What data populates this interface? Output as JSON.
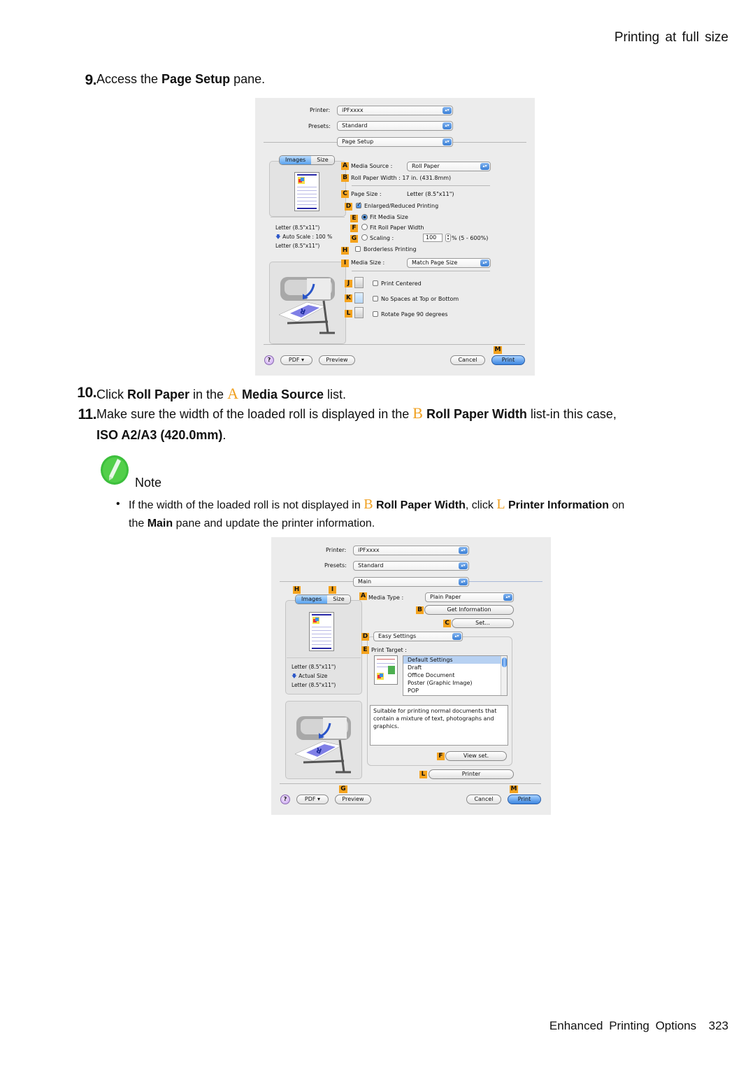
{
  "page": {
    "running_head": "Printing at full size",
    "footer_section": "Enhanced Printing Options",
    "page_number": "323"
  },
  "steps": [
    {
      "number": "9.",
      "parts": [
        "Access the ",
        "Page Setup",
        " pane."
      ]
    },
    {
      "number": "10.",
      "parts": [
        "Click ",
        "Roll Paper",
        " in the ",
        "A",
        " ",
        "Media Source",
        " list."
      ]
    },
    {
      "number": "11.",
      "parts": [
        "Make sure the width of the loaded roll is displayed in the ",
        "B",
        " ",
        "Roll Paper Width",
        " list-in this case,"
      ],
      "line2": [
        "ISO A2/A3 (420.0mm)",
        "."
      ]
    }
  ],
  "note": {
    "label": "Note",
    "bullet": "•",
    "parts": [
      "If the width of the loaded roll is not displayed in ",
      "B",
      " ",
      "Roll Paper Width",
      ", click ",
      "L",
      " ",
      "Printer Information",
      " on"
    ],
    "line2": [
      "the ",
      "Main",
      " pane and update the printer information."
    ]
  },
  "dialog1": {
    "printer_label": "Printer:",
    "printer_value": "iPFxxxx",
    "presets_label": "Presets:",
    "presets_value": "Standard",
    "pane_value": "Page Setup",
    "tabs": [
      "Images",
      "Size"
    ],
    "preview_info": [
      "Letter (8.5\"x11\")",
      "Auto Scale : 100 %",
      "Letter (8.5\"x11\")"
    ],
    "badges": [
      "A",
      "B",
      "C",
      "D",
      "E",
      "F",
      "G",
      "H",
      "I",
      "J",
      "K",
      "L",
      "M"
    ],
    "media_source_label": "Media Source :",
    "media_source_value": "Roll Paper",
    "roll_width_label": "Roll Paper Width :",
    "roll_width_value": "17 in. (431.8mm)",
    "page_size_label": "Page Size :",
    "page_size_value": "Letter (8.5\"x11\")",
    "enlarged_label": "Enlarged/Reduced Printing",
    "enlarged_checked": true,
    "fit_media_label": "Fit Media Size",
    "fit_media_selected": true,
    "fit_roll_label": "Fit Roll Paper Width",
    "scaling_label": "Scaling :",
    "scaling_value": "100",
    "scaling_range": "% (5 - 600%)",
    "borderless_label": "Borderless Printing",
    "borderless_checked": false,
    "media_size_label": "Media Size :",
    "media_size_value": "Match Page Size",
    "print_centered_label": "Print Centered",
    "no_spaces_label": "No Spaces at Top or Bottom",
    "rotate_label": "Rotate Page 90 degrees",
    "help": "?",
    "pdf": "PDF ▾",
    "preview": "Preview",
    "cancel": "Cancel",
    "print": "Print"
  },
  "dialog2": {
    "printer_label": "Printer:",
    "printer_value": "iPFxxxx",
    "presets_label": "Presets:",
    "presets_value": "Standard",
    "pane_value": "Main",
    "tabs": [
      "Images",
      "Size"
    ],
    "badges": [
      "H",
      "I",
      "A",
      "B",
      "C",
      "D",
      "E",
      "F",
      "L",
      "G",
      "M"
    ],
    "preview_info": [
      "Letter (8.5\"x11\")",
      "Actual Size",
      "Letter (8.5\"x11\")"
    ],
    "media_type_label": "Media Type :",
    "media_type_value": "Plain Paper",
    "get_info": "Get Information",
    "set": "Set...",
    "easy_settings": "Easy Settings",
    "print_target_label": "Print Target :",
    "print_targets": [
      "Default Settings",
      "Draft",
      "Office Document",
      "Poster (Graphic Image)",
      "POP"
    ],
    "selected_target": "Default Settings",
    "description": "Suitable for printing normal documents that contain a mixture of text, photographs and graphics.",
    "view_set": "View set.",
    "printer_button": "Printer",
    "help": "?",
    "pdf": "PDF ▾",
    "preview": "Preview",
    "cancel": "Cancel",
    "print": "Print"
  },
  "colors": {
    "accent_letter": "#f0a020",
    "badge": "#f4a31e",
    "note_green": "#3cbf3c"
  }
}
